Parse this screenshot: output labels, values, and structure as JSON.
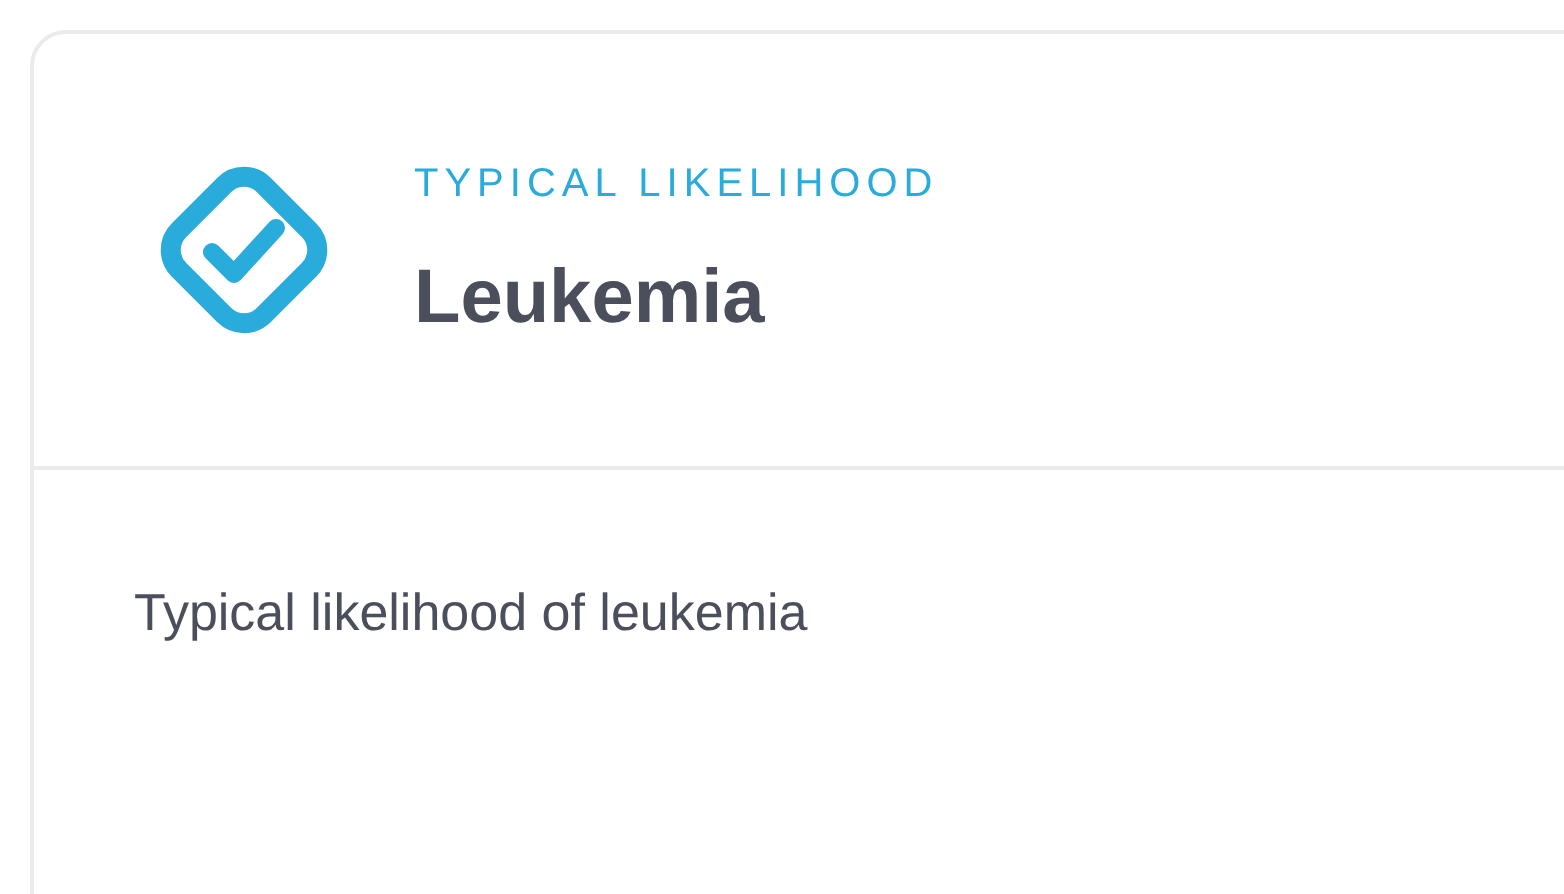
{
  "card": {
    "label": "TYPICAL LIKELIHOOD",
    "title": "Leukemia",
    "description": "Typical likelihood of leukemia"
  }
}
